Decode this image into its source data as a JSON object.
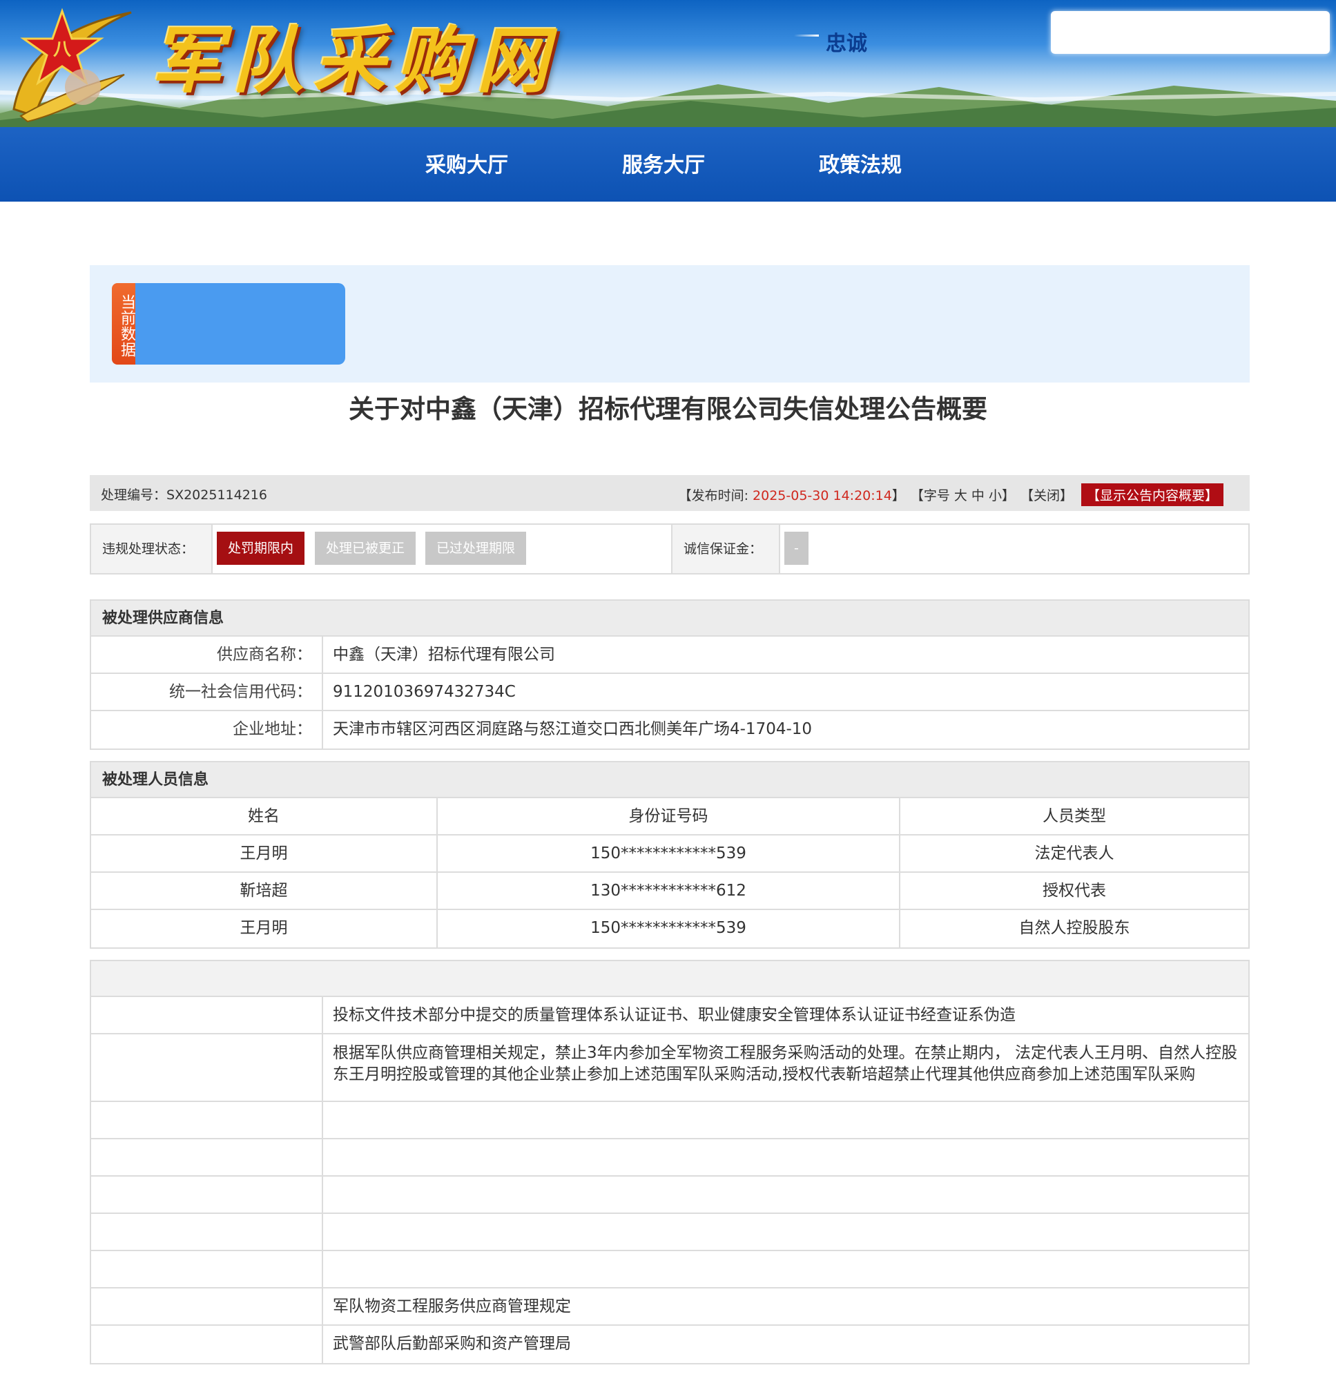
{
  "header": {
    "site_logo": "军队采购网",
    "motto": "忠诚"
  },
  "nav": {
    "items": [
      "采购大厅",
      "服务大厅",
      "政策法规"
    ]
  },
  "data_strip": {
    "tag": "当前数据"
  },
  "notice": {
    "title": "关于对中鑫（天津）招标代理有限公司失信处理公告概要",
    "case_no_label": "处理编号：",
    "case_no": "SX2025114216",
    "publish_label": "【发布时间: ",
    "publish_time": "2025-05-30 14:20:14",
    "publish_close": "】",
    "font_size_label": "【字号 大 中 小】",
    "close_label": "【关闭】",
    "show_summary_label": "【显示公告内容概要】"
  },
  "status": {
    "label": "违规处理状态：",
    "active": "处罚期限内",
    "corrected": "处理已被更正",
    "expired": "已过处理期限",
    "deposit_label": "诚信保证金：",
    "deposit_value": "-"
  },
  "supplier": {
    "section_title": "被处理供应商信息",
    "rows": [
      {
        "key": "供应商名称：",
        "value": "中鑫（天津）招标代理有限公司"
      },
      {
        "key": "统一社会信用代码：",
        "value": "91120103697432734C"
      },
      {
        "key": "企业地址：",
        "value": "天津市市辖区河西区洞庭路与怒江道交口西北侧美年广场4-1704-10"
      }
    ]
  },
  "persons": {
    "section_title": "被处理人员信息",
    "headers": [
      "姓名",
      "身份证号码",
      "人员类型"
    ],
    "rows": [
      [
        "王月明",
        "150************539",
        "法定代表人"
      ],
      [
        "靳培超",
        "130************612",
        "授权代表"
      ],
      [
        "王月明",
        "150************539",
        "自然人控股股东"
      ]
    ]
  },
  "details": {
    "violation": "投标文件技术部分中提交的质量管理体系认证证书、职业健康安全管理体系认证证书经查证系伪造",
    "penalty": "根据军队供应商管理相关规定，禁止3年内参加全军物资工程服务采购活动的处理。在禁止期内， 法定代表人王月明、自然人控股东王月明控股或管理的其他企业禁止参加上述范围军队采购活动,授权代表靳培超禁止代理其他供应商参加上述范围军队采购",
    "basis": "军队物资工程服务供应商管理规定",
    "authority": "武警部队后勤部采购和资产管理局"
  },
  "colors": {
    "nav_blue": "#0d52b3",
    "accent_red": "#b00d14",
    "date_red": "#d0281e",
    "tag_orange": "#e24818",
    "strip_blue": "#e7f2fd"
  }
}
